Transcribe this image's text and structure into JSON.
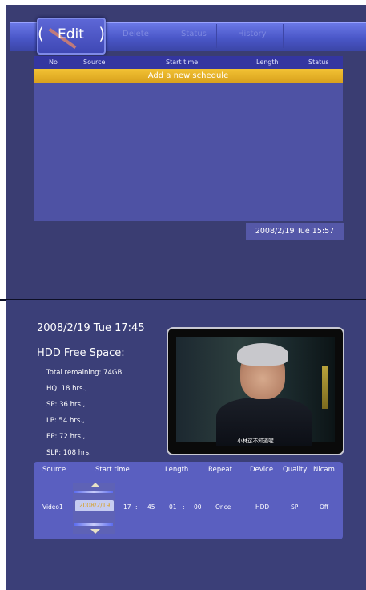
{
  "top": {
    "tabs": {
      "edit": "Edit",
      "delete": "Delete",
      "status": "Status",
      "history": "History"
    },
    "schedule": {
      "headers": {
        "no": "No",
        "source": "Source",
        "start_time": "Start time",
        "length": "Length",
        "status": "Status"
      },
      "add_row": "Add a new schedule"
    },
    "datetime": "2008/2/19 Tue 15:57"
  },
  "bottom": {
    "datetime": "2008/2/19 Tue 17:45",
    "hdd": {
      "title": "HDD Free Space:",
      "total": "Total remaining: 74GB.",
      "hq": "HQ: 18 hrs.,",
      "sp": "SP: 36 hrs.,",
      "lp": "LP: 54 hrs.,",
      "ep": "EP: 72 hrs.,",
      "slp": "SLP: 108 hrs."
    },
    "preview": {
      "caption": "小林这不知道呢"
    },
    "recording": {
      "headers": {
        "source": "Source",
        "start_time": "Start time",
        "length": "Length",
        "repeat": "Repeat",
        "device": "Device",
        "quality": "Quality",
        "nicam": "Nicam"
      },
      "values": {
        "source": "Video1",
        "date": "2008/2/19",
        "hour": "17",
        "sep1": ":",
        "minute": "45",
        "length_h": "01",
        "sep2": ":",
        "length_m": "00",
        "repeat": "Once",
        "device": "HDD",
        "quality": "SP",
        "nicam": "Off"
      }
    }
  }
}
